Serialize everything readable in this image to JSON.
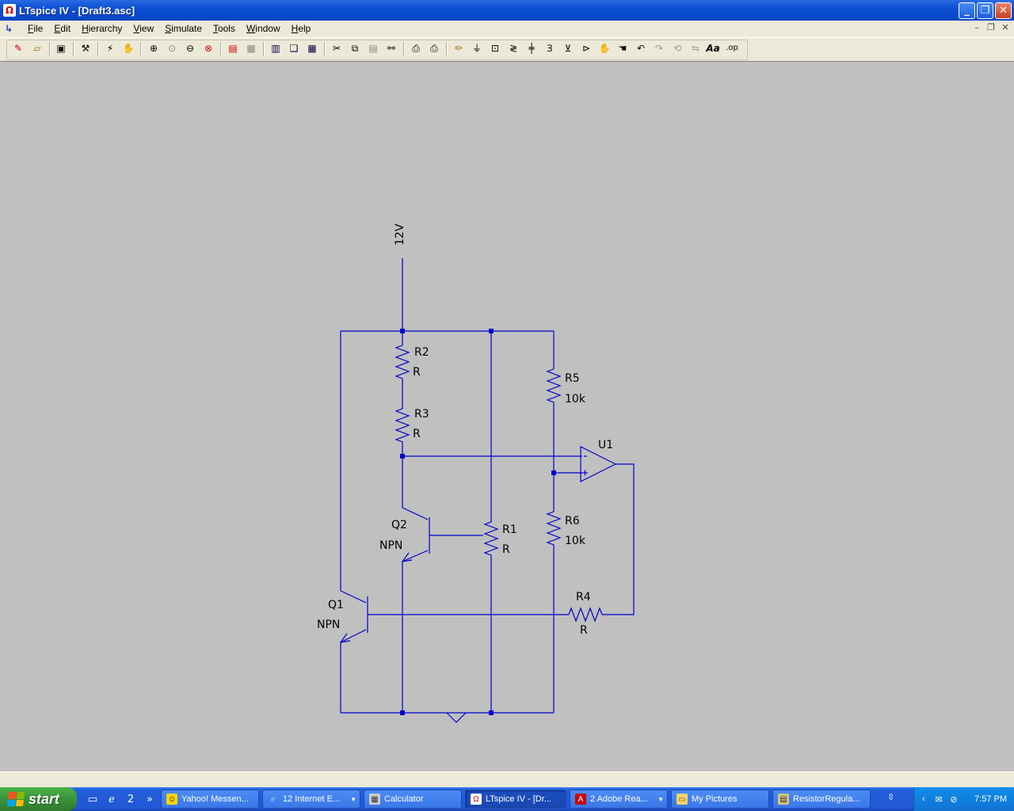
{
  "window": {
    "title": "LTspice IV - [Draft3.asc]",
    "minimize": "_",
    "restore": "❐",
    "close": "✕"
  },
  "menu": {
    "items": [
      "File",
      "Edit",
      "Hierarchy",
      "View",
      "Simulate",
      "Tools",
      "Window",
      "Help"
    ]
  },
  "toolbar": {
    "icons": [
      "new-schematic-icon",
      "open-icon",
      "save-icon",
      "control-panel-icon",
      "run-icon",
      "halt-icon",
      "zoom-in-icon",
      "pan-icon",
      "zoom-out-icon",
      "zoom-fit-icon",
      "autorange-icon",
      "grid-icon",
      "tile-horizontal-icon",
      "cascade-icon",
      "tile-vertical-icon",
      "cut-icon",
      "copy-icon",
      "paste-icon",
      "find-icon",
      "print-setup-icon",
      "print-icon",
      "wire-icon",
      "ground-icon",
      "label-icon",
      "resistor-icon",
      "capacitor-icon",
      "inductor-icon",
      "diode-icon",
      "component-icon",
      "move-icon",
      "drag-icon",
      "undo-icon",
      "redo-icon",
      "rotate-icon",
      "mirror-icon",
      "text-icon",
      "spice-directive-icon"
    ],
    "text_label": "Aa",
    "op_label": ".op"
  },
  "schematic": {
    "color": "#0000cc",
    "labels": {
      "supply": "12V",
      "r2_name": "R2",
      "r2_value": "R",
      "r3_name": "R3",
      "r3_value": "R",
      "r5_name": "R5",
      "r5_value": "10k",
      "r6_name": "R6",
      "r6_value": "10k",
      "r1_name": "R1",
      "r1_value": "R",
      "r4_name": "R4",
      "r4_value": "R",
      "u1_name": "U1",
      "q2_name": "Q2",
      "q2_type": "NPN",
      "q1_name": "Q1",
      "q1_type": "NPN"
    }
  },
  "taskbar": {
    "start_label": "start",
    "quicklaunch_more": "»",
    "quicklaunch_badge": "2",
    "buttons": [
      {
        "label": "Yahoo! Messen...",
        "icon": "yahoo-messenger-icon"
      },
      {
        "label": "12 Internet E...",
        "icon": "internet-explorer-icon"
      },
      {
        "label": "Calculator",
        "icon": "calculator-icon"
      },
      {
        "label": "LTspice IV - [Dr...",
        "icon": "ltspice-icon"
      },
      {
        "label": "2 Adobe Rea...",
        "icon": "adobe-reader-icon"
      },
      {
        "label": "My Pictures",
        "icon": "folder-icon"
      },
      {
        "label": "ResistorRegula...",
        "icon": "document-icon"
      }
    ],
    "clock": "7:57 PM"
  }
}
